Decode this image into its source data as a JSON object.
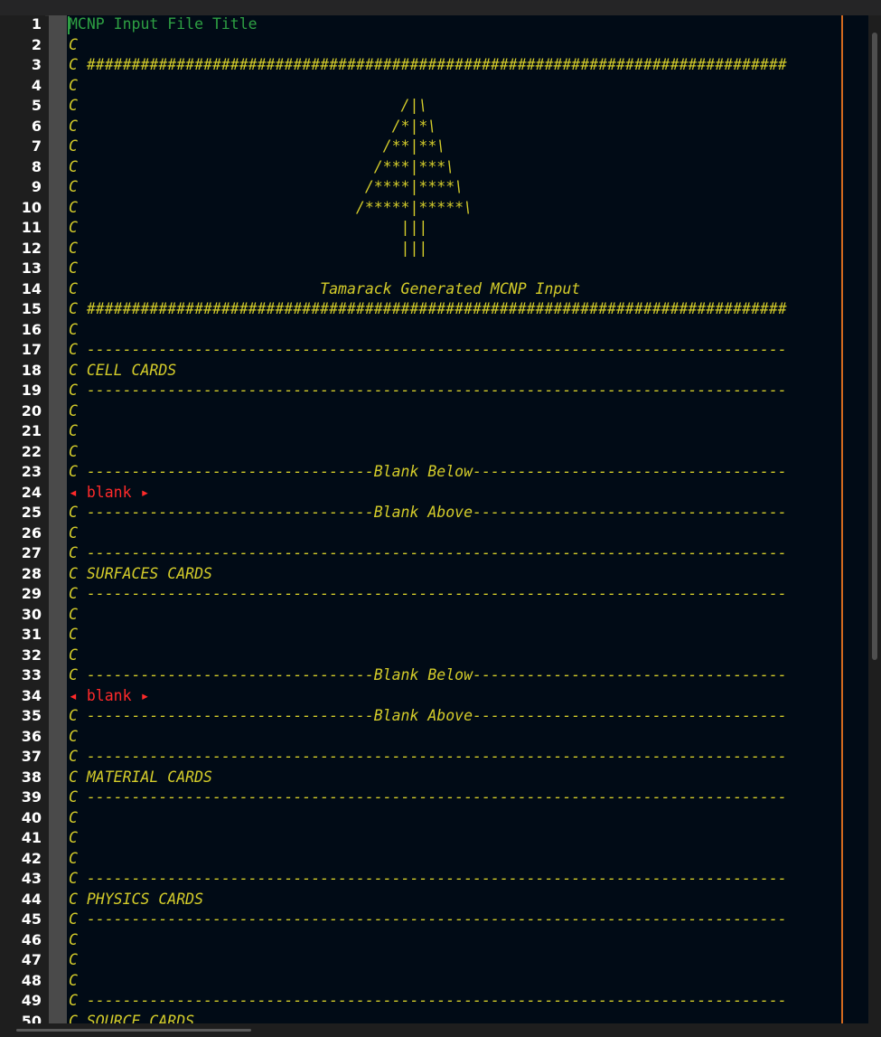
{
  "editor": {
    "lines": [
      {
        "n": "1",
        "text": "MCNP Input File Title",
        "kind": "title"
      },
      {
        "n": "2",
        "text": "C",
        "kind": "comment"
      },
      {
        "n": "3",
        "text": "C ##############################################################################",
        "kind": "comment"
      },
      {
        "n": "4",
        "text": "C",
        "kind": "comment"
      },
      {
        "n": "5",
        "text": "C                                    /|\\",
        "kind": "comment"
      },
      {
        "n": "6",
        "text": "C                                   /*|*\\",
        "kind": "comment"
      },
      {
        "n": "7",
        "text": "C                                  /**|**\\",
        "kind": "comment"
      },
      {
        "n": "8",
        "text": "C                                 /***|***\\",
        "kind": "comment"
      },
      {
        "n": "9",
        "text": "C                                /****|****\\",
        "kind": "comment"
      },
      {
        "n": "10",
        "text": "C                               /*****|*****\\",
        "kind": "comment"
      },
      {
        "n": "11",
        "text": "C                                    |||",
        "kind": "comment"
      },
      {
        "n": "12",
        "text": "C                                    |||",
        "kind": "comment"
      },
      {
        "n": "13",
        "text": "C",
        "kind": "comment"
      },
      {
        "n": "14",
        "text": "C                           Tamarack Generated MCNP Input",
        "kind": "comment"
      },
      {
        "n": "15",
        "text": "C ##############################################################################",
        "kind": "comment"
      },
      {
        "n": "16",
        "text": "C",
        "kind": "comment"
      },
      {
        "n": "17",
        "text": "C ------------------------------------------------------------------------------",
        "kind": "comment"
      },
      {
        "n": "18",
        "text": "C CELL CARDS",
        "kind": "comment"
      },
      {
        "n": "19",
        "text": "C ------------------------------------------------------------------------------",
        "kind": "comment"
      },
      {
        "n": "20",
        "text": "C",
        "kind": "comment"
      },
      {
        "n": "21",
        "text": "C",
        "kind": "comment"
      },
      {
        "n": "22",
        "text": "C",
        "kind": "comment"
      },
      {
        "n": "23",
        "text": "C --------------------------------Blank Below-----------------------------------",
        "kind": "comment"
      },
      {
        "n": "24",
        "text": "◂ blank ▸",
        "kind": "blank"
      },
      {
        "n": "25",
        "text": "C --------------------------------Blank Above-----------------------------------",
        "kind": "comment"
      },
      {
        "n": "26",
        "text": "C",
        "kind": "comment"
      },
      {
        "n": "27",
        "text": "C ------------------------------------------------------------------------------",
        "kind": "comment"
      },
      {
        "n": "28",
        "text": "C SURFACES CARDS",
        "kind": "comment"
      },
      {
        "n": "29",
        "text": "C ------------------------------------------------------------------------------",
        "kind": "comment"
      },
      {
        "n": "30",
        "text": "C",
        "kind": "comment"
      },
      {
        "n": "31",
        "text": "C",
        "kind": "comment"
      },
      {
        "n": "32",
        "text": "C",
        "kind": "comment"
      },
      {
        "n": "33",
        "text": "C --------------------------------Blank Below-----------------------------------",
        "kind": "comment"
      },
      {
        "n": "34",
        "text": "◂ blank ▸",
        "kind": "blank"
      },
      {
        "n": "35",
        "text": "C --------------------------------Blank Above-----------------------------------",
        "kind": "comment"
      },
      {
        "n": "36",
        "text": "C",
        "kind": "comment"
      },
      {
        "n": "37",
        "text": "C ------------------------------------------------------------------------------",
        "kind": "comment"
      },
      {
        "n": "38",
        "text": "C MATERIAL CARDS",
        "kind": "comment"
      },
      {
        "n": "39",
        "text": "C ------------------------------------------------------------------------------",
        "kind": "comment"
      },
      {
        "n": "40",
        "text": "C",
        "kind": "comment"
      },
      {
        "n": "41",
        "text": "C",
        "kind": "comment"
      },
      {
        "n": "42",
        "text": "C",
        "kind": "comment"
      },
      {
        "n": "43",
        "text": "C ------------------------------------------------------------------------------",
        "kind": "comment"
      },
      {
        "n": "44",
        "text": "C PHYSICS CARDS",
        "kind": "comment"
      },
      {
        "n": "45",
        "text": "C ------------------------------------------------------------------------------",
        "kind": "comment"
      },
      {
        "n": "46",
        "text": "C",
        "kind": "comment"
      },
      {
        "n": "47",
        "text": "C",
        "kind": "comment"
      },
      {
        "n": "48",
        "text": "C",
        "kind": "comment"
      },
      {
        "n": "49",
        "text": "C ------------------------------------------------------------------------------",
        "kind": "comment"
      },
      {
        "n": "50",
        "text": "C SOURCE CARDS",
        "kind": "comment"
      }
    ]
  },
  "colors": {
    "comment": "#d4cc2a",
    "title": "#2ea043",
    "blank_marker": "#ff2a2a",
    "background": "#010b16",
    "margin_line": "#d2691e"
  }
}
